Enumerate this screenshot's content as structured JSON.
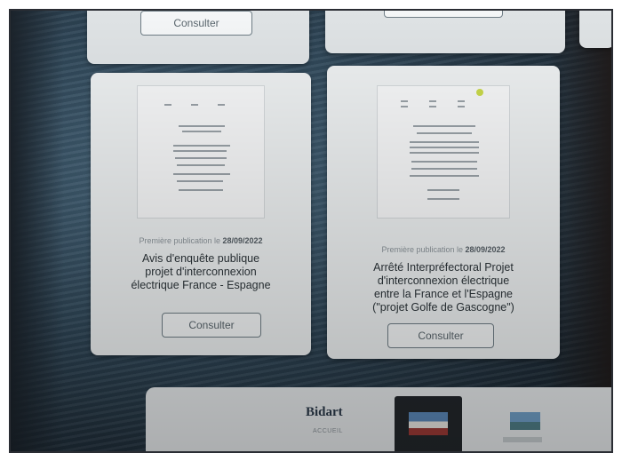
{
  "cards_top": [
    {
      "button_label": "Consulter"
    }
  ],
  "cards": [
    {
      "pub_prefix": "Première publication le",
      "pub_date": "28/09/2022",
      "title_lines": [
        "Avis d'enquête publique",
        "projet d'interconnexion",
        "électrique France - Espagne"
      ],
      "button_label": "Consulter"
    },
    {
      "pub_prefix": "Première publication le",
      "pub_date": "28/09/2022",
      "title_lines": [
        "Arrêté Interpréfectoral Projet",
        "d'interconnexion électrique",
        "entre la France et l'Espagne",
        "(\"projet Golfe de Gascogne\")"
      ],
      "button_label": "Consulter"
    }
  ],
  "nav": {
    "logo": "Bidart",
    "home_label": "ACCUEIL",
    "tile_icon": "town-hall-photo-icon",
    "thumb_icon": "coastline-photo-icon"
  },
  "colors": {
    "card_bg": "#edf0f1",
    "button_border": "#6f7d85",
    "nav_bg": "#e6e9eb",
    "accent_dot": "#c9d94a"
  }
}
